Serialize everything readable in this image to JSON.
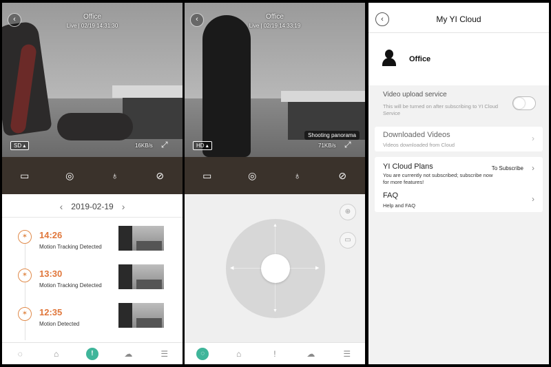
{
  "screen1": {
    "camera_name": "Office",
    "live_status": "Live | 02/19 14:31:30",
    "quality": "SD ▴",
    "rate": "16KB/s",
    "date": "2019-02-19",
    "events": [
      {
        "time": "14:26",
        "label": "Motion Tracking Detected"
      },
      {
        "time": "13:30",
        "label": "Motion Tracking Detected"
      },
      {
        "time": "12:35",
        "label": "Motion Detected"
      }
    ]
  },
  "screen2": {
    "camera_name": "Office",
    "live_status": "Live | 02/19 14:33:19",
    "quality": "HD ▴",
    "rate": "71KB/s",
    "panorama_label": "Shooting panorama"
  },
  "cloud": {
    "title": "My YI Cloud",
    "profile_name": "Office",
    "video_upload_title": "Video upload service",
    "video_upload_desc": "This will be turned on after subscribing to YI Cloud Service",
    "downloaded_title": "Downloaded Videos",
    "downloaded_desc": "Videos downloaded from Cloud",
    "plans_title": "YI Cloud Plans",
    "plans_action": "To Subscribe",
    "plans_desc": "You are currently not subscribed; subscribe now for more features!",
    "faq_title": "FAQ",
    "faq_desc": "Help and FAQ"
  },
  "colors": {
    "accent": "#e0763a",
    "active_tab": "#3fb59a",
    "control_bar": "#3a322b"
  },
  "icons": [
    "record-video-icon",
    "snapshot-icon",
    "microphone-icon",
    "mute-icon",
    "expand-icon",
    "back-icon",
    "chevron-right-icon",
    "person-icon",
    "motion-icon",
    "home-tab-icon",
    "bookmark-tab-icon",
    "alert-tab-icon",
    "cloud-upload-tab-icon",
    "settings-tab-icon",
    "panorama-icon",
    "gallery-icon"
  ]
}
